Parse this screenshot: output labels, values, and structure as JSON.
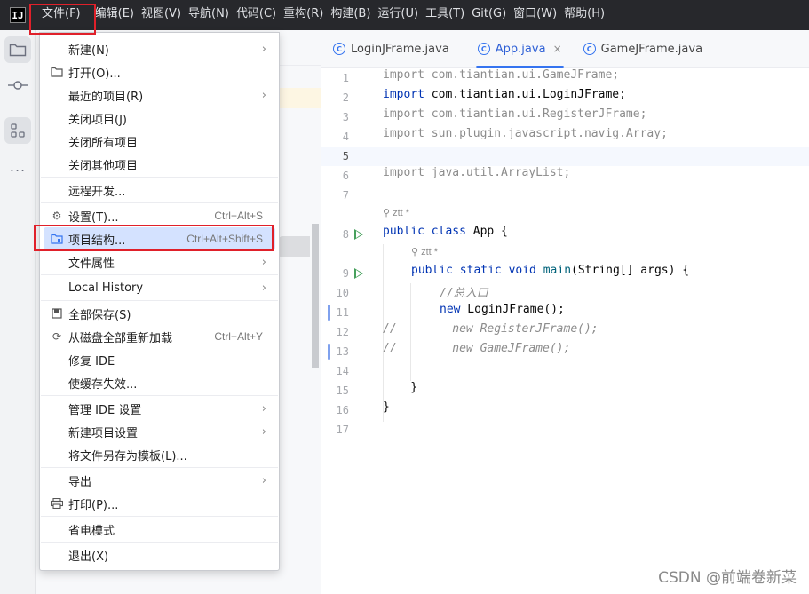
{
  "app": {
    "logo_text": "IJ"
  },
  "menubar": {
    "items": [
      {
        "label": "文件(F)"
      },
      {
        "label": "编辑(E)"
      },
      {
        "label": "视图(V)"
      },
      {
        "label": "导航(N)"
      },
      {
        "label": "代码(C)"
      },
      {
        "label": "重构(R)"
      },
      {
        "label": "构建(B)"
      },
      {
        "label": "运行(U)"
      },
      {
        "label": "工具(T)"
      },
      {
        "label": "Git(G)"
      },
      {
        "label": "窗口(W)"
      },
      {
        "label": "帮助(H)"
      }
    ]
  },
  "toolstrip": {
    "icons": [
      "folder-icon",
      "commit-icon",
      "structure-icon",
      "more-icon"
    ],
    "more_label": "..."
  },
  "tabs": [
    {
      "label": "LoginJFrame.java",
      "icon_letter": "C",
      "active": false
    },
    {
      "label": "App.java",
      "icon_letter": "C",
      "active": true,
      "close": "×"
    },
    {
      "label": "GameJFrame.java",
      "icon_letter": "C",
      "active": false
    }
  ],
  "editor": {
    "line_numbers": [
      "1",
      "2",
      "3",
      "4",
      "5",
      "6",
      "7",
      "8",
      "9",
      "10",
      "11",
      "12",
      "13",
      "14",
      "15",
      "16",
      "17"
    ],
    "lines": [
      {
        "n": 1,
        "text": "import com.tiantian.ui.GameJFrame;",
        "style": "dim"
      },
      {
        "n": 2,
        "text": "import com.tiantian.ui.LoginJFrame;",
        "style": "mixed"
      },
      {
        "n": 3,
        "text": "import com.tiantian.ui.RegisterJFrame;",
        "style": "dim"
      },
      {
        "n": 4,
        "text": "import sun.plugin.javascript.navig.Array;",
        "style": "dim"
      },
      {
        "n": 5,
        "text": "",
        "style": "plain"
      },
      {
        "n": 6,
        "text": "import java.util.ArrayList;",
        "style": "dim"
      },
      {
        "n": 7,
        "text": "",
        "style": "plain"
      },
      {
        "n": 8,
        "text": "public class App {",
        "style": "decl"
      },
      {
        "n": 9,
        "text": "    public static void main(String[] args) {",
        "style": "decl"
      },
      {
        "n": 10,
        "text": "        //总入口",
        "style": "comment"
      },
      {
        "n": 11,
        "text": "        new LoginJFrame();",
        "style": "decl"
      },
      {
        "n": 12,
        "text": "//        new RegisterJFrame();",
        "style": "comment"
      },
      {
        "n": 13,
        "text": "//        new GameJFrame();",
        "style": "comment"
      },
      {
        "n": 14,
        "text": "",
        "style": "plain"
      },
      {
        "n": 15,
        "text": "    }",
        "style": "plain"
      },
      {
        "n": 16,
        "text": "}",
        "style": "plain"
      },
      {
        "n": 17,
        "text": "",
        "style": "plain"
      }
    ],
    "inlay_author_1": "ztt *",
    "inlay_author_2": "ztt *",
    "code": {
      "l2_kw": "import",
      "l2_rest": " com.tiantian.ui.LoginJFrame;",
      "l8_kw": "public class",
      "l8_rest": " App {",
      "l9_kw": "public static void",
      "l9_fn": "main",
      "l9_rest": "(String[] args) {",
      "l11_kw": "new",
      "l11_rest": " LoginJFrame();"
    }
  },
  "file_menu": {
    "items": [
      {
        "label": "新建(N)",
        "submenu": true
      },
      {
        "label": "打开(O)...",
        "icon": "folder-open-icon"
      },
      {
        "label": "最近的项目(R)",
        "submenu": true
      },
      {
        "label": "关闭项目(J)"
      },
      {
        "label": "关闭所有项目"
      },
      {
        "label": "关闭其他项目"
      },
      {
        "label": "远程开发..."
      },
      {
        "label": "设置(T)...",
        "shortcut": "Ctrl+Alt+S",
        "icon": "gear-icon"
      },
      {
        "label": "项目结构...",
        "shortcut": "Ctrl+Alt+Shift+S",
        "icon": "project-structure-icon",
        "selected": true
      },
      {
        "label": "文件属性",
        "submenu": true
      },
      {
        "label": "Local History",
        "submenu": true
      },
      {
        "label": "全部保存(S)",
        "icon": "save-icon"
      },
      {
        "label": "从磁盘全部重新加载",
        "shortcut": "Ctrl+Alt+Y",
        "icon": "reload-icon"
      },
      {
        "label": "修复 IDE"
      },
      {
        "label": "使缓存失效..."
      },
      {
        "label": "管理 IDE 设置",
        "submenu": true
      },
      {
        "label": "新建项目设置",
        "submenu": true
      },
      {
        "label": "将文件另存为模板(L)..."
      },
      {
        "label": "导出",
        "submenu": true
      },
      {
        "label": "打印(P)...",
        "icon": "print-icon"
      },
      {
        "label": "省电模式"
      },
      {
        "label": "退出(X)"
      }
    ],
    "submenu_arrow": "›"
  },
  "watermark": "CSDN @前端卷新菜",
  "colors": {
    "menubar_bg": "#27282c",
    "selection_bg": "#d4e2ff",
    "highlight_box": "#e0202a",
    "accent": "#3574f0",
    "run_icon": "#47a05c"
  }
}
